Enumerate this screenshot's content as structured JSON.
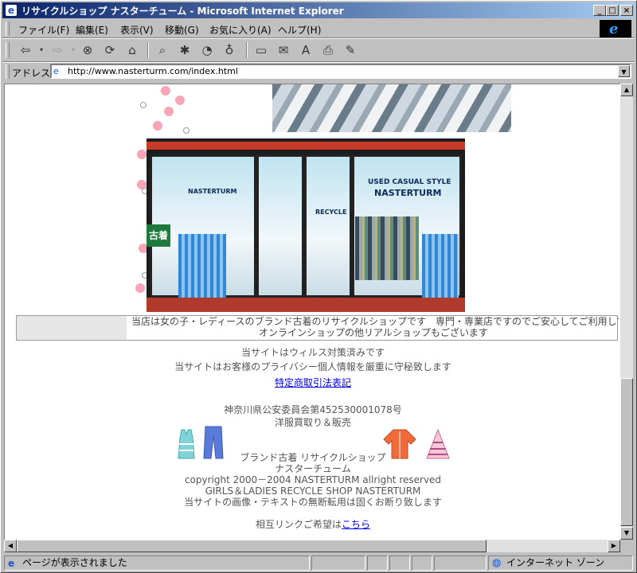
{
  "window": {
    "title": "リサイクルショップ  ナスターチューム - Microsoft Internet Explorer",
    "buttons": {
      "minimize": "_",
      "maximize": "□",
      "close": "×"
    }
  },
  "menu": {
    "items": [
      {
        "label": "ファイル(F)"
      },
      {
        "label": "編集(E)"
      },
      {
        "label": "表示(V)"
      },
      {
        "label": "移動(G)"
      },
      {
        "label": "お気に入り(A)"
      },
      {
        "label": "ヘルプ(H)"
      }
    ]
  },
  "toolbar": {
    "icons": [
      "back-icon",
      "forward-icon",
      "stop-icon",
      "refresh-icon",
      "home-icon",
      "search-icon",
      "favorites-icon",
      "history-icon",
      "channels-icon",
      "fullscreen-icon",
      "mail-icon",
      "font-icon",
      "print-icon",
      "edit-icon"
    ]
  },
  "address": {
    "label": "アドレス",
    "url": "http://www.nasterturm.com/index.html"
  },
  "page": {
    "store_sign_1": "USED CASUAL STYLE",
    "store_sign_2": "NASTERTURM",
    "store_sign_3": "NASTERTURM",
    "store_sign_4": "RECYCLE",
    "store_green": "古着",
    "info_line_1": "当店は女の子・レディースのブランド古着のリサイクルショップです　専門・専業店ですのでご安心してご利用してくだ",
    "info_line_2": "オンラインショップの他リアルショップもございます",
    "virus": "当サイトはウィルス対策済みです",
    "privacy": "当サイトはお客様のプライバシー個人情報を厳重に守秘致します",
    "law_link": "特定商取引法表記",
    "license": "神奈川県公安委員会第452530001078号",
    "business": "洋服買取り＆販売",
    "shop_line": "ブランド古着  リサイクルショップ",
    "shop_name": "ナスターチューム",
    "copyright": "copyright  2000－2004  NASTERTURM  allright  reserved",
    "english": "GIRLS＆LADIES  RECYCLE  SHOP  NASTERTURM",
    "notice": "当サイトの画像・テキストの無断転用は固くお断り致します",
    "mutual_prefix": "相互リンクご希望は",
    "mutual_link": "こちら"
  },
  "status": {
    "text": "ページが表示されました",
    "zone": "インターネット ゾーン"
  }
}
